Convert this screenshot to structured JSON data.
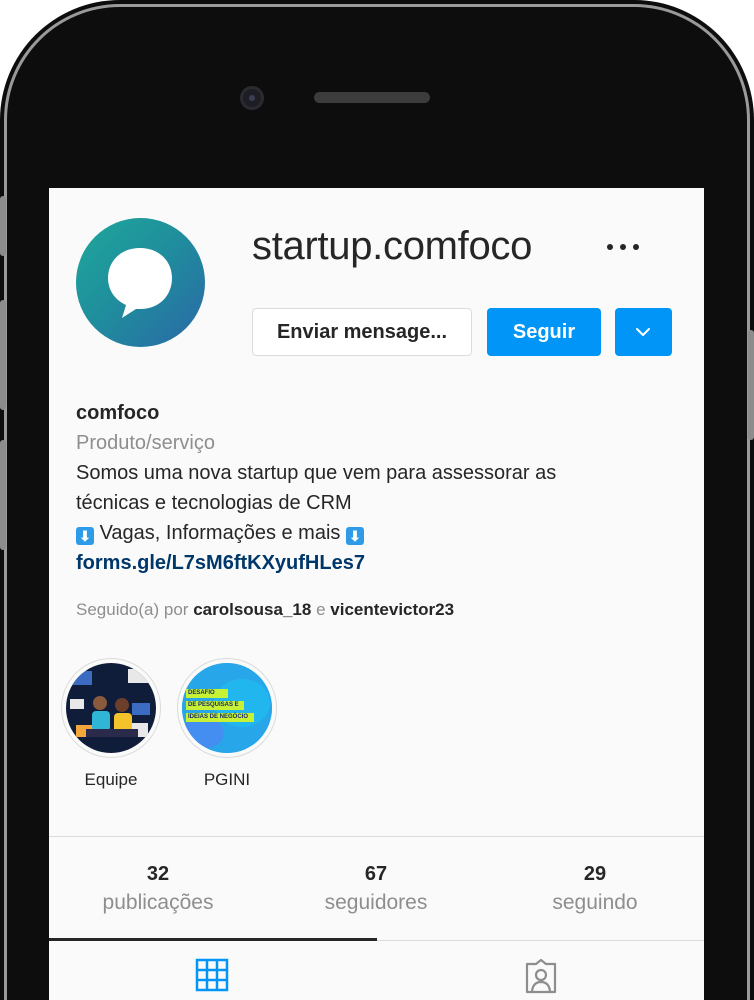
{
  "profile": {
    "username": "startup.comfoco",
    "more_icon": "more-horizontal-icon",
    "message_label": "Enviar mensage...",
    "follow_label": "Seguir",
    "dropdown_icon": "chevron-down-icon",
    "accent_color": "#0095f6"
  },
  "bio": {
    "name": "comfoco",
    "category": "Produto/serviço",
    "line1": "Somos uma nova startup que vem para assessorar as",
    "line2": "técnicas e tecnologias de CRM",
    "line3": "Vagas, Informações e mais",
    "arrow_emoji": "⬇",
    "link": "forms.gle/L7sM6ftKXyufHLes7"
  },
  "followed_by": {
    "prefix": "Seguido(a) por",
    "user1": "carolsousa_18",
    "conj": "e",
    "user2": "vicentevictor23"
  },
  "highlights": [
    {
      "label": "Equipe"
    },
    {
      "label": "PGINI",
      "banner_lines": [
        "DESAFIO",
        "DE PESQUISAS E",
        "IDEIAS DE NEGÓCIO"
      ]
    }
  ],
  "stats": [
    {
      "value": "32",
      "label": "publicações"
    },
    {
      "value": "67",
      "label": "seguidores"
    },
    {
      "value": "29",
      "label": "seguindo"
    }
  ],
  "tabs": [
    {
      "icon": "grid-icon",
      "active": true
    },
    {
      "icon": "tagged-user-icon",
      "active": false
    }
  ]
}
